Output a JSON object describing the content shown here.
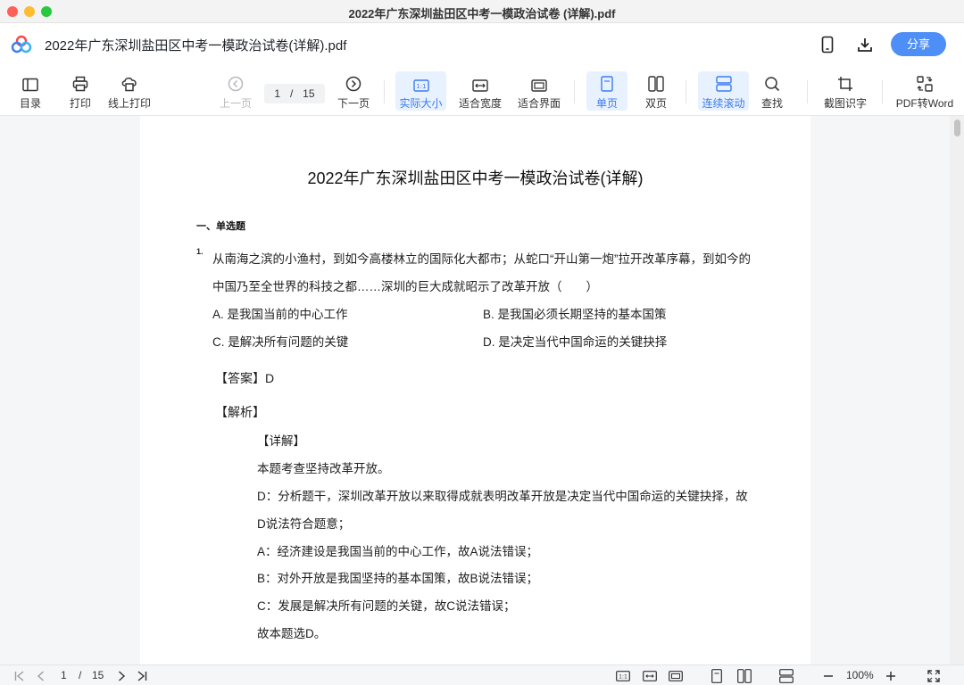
{
  "window": {
    "title": "2022年广东深圳盐田区中考一模政治试卷 (详解).pdf"
  },
  "header": {
    "doc_title": "2022年广东深圳盐田区中考一模政治试卷(详解).pdf",
    "share_label": "分享"
  },
  "toolbar": {
    "toc": "目录",
    "print": "打印",
    "online_print": "线上打印",
    "prev_page": "上一页",
    "current_page": "1",
    "page_sep": "/",
    "total_pages": "15",
    "next_page": "下一页",
    "actual_size": "实际大小",
    "fit_width": "适合宽度",
    "fit_page": "适合界面",
    "single_page": "单页",
    "double_page": "双页",
    "continuous_scroll": "连续滚动",
    "search": "查找",
    "screenshot_ocr": "截图识字",
    "pdf_to_word": "PDF转Word",
    "accent_color": "#3c7cf0"
  },
  "document": {
    "title": "2022年广东深圳盐田区中考一模政治试卷(详解)",
    "section": "一、单选题",
    "question_number": "1.",
    "question_lines": [
      "从南海之滨的小渔村，到如今高楼林立的国际化大都市；从蛇口“开山第一炮”拉开改革序幕，到如今的",
      "中国乃至全世界的科技之都……深圳的巨大成就昭示了改革开放（　　）"
    ],
    "options": {
      "a": "A. 是我国当前的中心工作",
      "b": "B. 是我国必须长期坚持的基本国策",
      "c": "C. 是解决所有问题的关键",
      "d": "D. 是决定当代中国命运的关键抉择"
    },
    "answer": "【答案】D",
    "analysis_heading": "【解析】",
    "explanation_lines": [
      "【详解】",
      "本题考查坚持改革开放。",
      "D：分析题干，深圳改革开放以来取得成就表明改革开放是决定当代中国命运的关键抉择，故",
      "D说法符合题意；",
      "A：经济建设是我国当前的中心工作，故A说法错误；",
      "B：对外开放是我国坚持的基本国策，故B说法错误；",
      "C：发展是解决所有问题的关键，故C说法错误；",
      "故本题选D。"
    ]
  },
  "statusbar": {
    "current_page": "1",
    "page_sep": "/",
    "total_pages": "15",
    "zoom": "100%"
  }
}
